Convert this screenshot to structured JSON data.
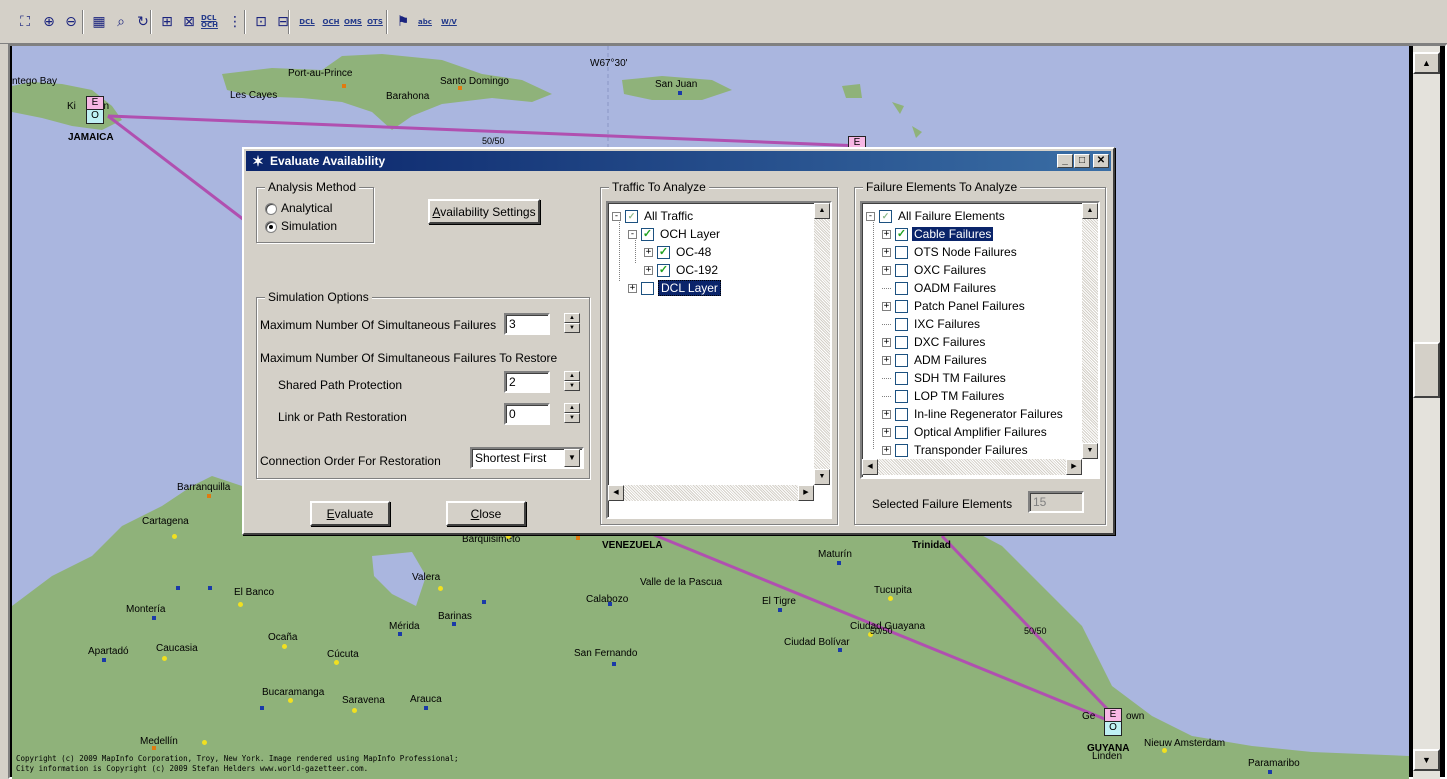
{
  "toolbar": {
    "buttons": [
      {
        "icon": "select-network-icon",
        "glyph": "⛶"
      },
      {
        "icon": "zoom-in-icon",
        "glyph": "⊕"
      },
      {
        "icon": "zoom-out-icon",
        "glyph": "⊖"
      },
      {
        "icon": "grid-view-icon",
        "glyph": "▦"
      },
      {
        "icon": "zoom-region-icon",
        "glyph": "⌕"
      },
      {
        "icon": "zoom-rotate-icon",
        "glyph": "↻"
      },
      {
        "icon": "add-node-icon",
        "glyph": "⊞"
      },
      {
        "icon": "add-link-icon",
        "glyph": "⊠"
      },
      {
        "icon": "dcl-och-icon",
        "label": "DCL OCH"
      },
      {
        "icon": "layer-stack-icon",
        "glyph": "⋮"
      },
      {
        "icon": "expand-icon",
        "glyph": "⊡"
      },
      {
        "icon": "collapse-icon",
        "glyph": "⊟"
      },
      {
        "icon": "dcl-layer-icon",
        "label": "DCL"
      },
      {
        "icon": "och-layer-icon",
        "label": "OCH"
      },
      {
        "icon": "oms-layer-icon",
        "label": "OMS"
      },
      {
        "icon": "ots-layer-icon",
        "label": "OTS"
      },
      {
        "icon": "flag-icon",
        "glyph": "⚑"
      },
      {
        "icon": "label-abc-icon",
        "label": "abc"
      },
      {
        "icon": "label-wv-icon",
        "label": "W/V"
      }
    ]
  },
  "map": {
    "grid_label": "W67°30'",
    "places": [
      {
        "name": "ntego Bay"
      },
      {
        "name": "Port-au-Prince"
      },
      {
        "name": "Santo Domingo"
      },
      {
        "name": "San Juan"
      },
      {
        "name": "Les Cayes"
      },
      {
        "name": "Barahona"
      },
      {
        "name": "Barranquilla"
      },
      {
        "name": "Cartagena"
      },
      {
        "name": "Barquisimeto"
      },
      {
        "name": "Maturín"
      },
      {
        "name": "Valera"
      },
      {
        "name": "Valle de la Pascua"
      },
      {
        "name": "Tucupita"
      },
      {
        "name": "El Banco"
      },
      {
        "name": "Calabozo"
      },
      {
        "name": "El Tigre"
      },
      {
        "name": "Montería"
      },
      {
        "name": "Barinas"
      },
      {
        "name": "Mérida"
      },
      {
        "name": "Ciudad Guayana"
      },
      {
        "name": "Ocaña"
      },
      {
        "name": "Ciudad Bolívar"
      },
      {
        "name": "Caucasia"
      },
      {
        "name": "Apartadó"
      },
      {
        "name": "Cúcuta"
      },
      {
        "name": "San Fernando"
      },
      {
        "name": "Bucaramanga"
      },
      {
        "name": "Saravena"
      },
      {
        "name": "Arauca"
      },
      {
        "name": "Medellín"
      },
      {
        "name": "Nieuw Amsterdam"
      },
      {
        "name": "Paramaribo"
      },
      {
        "name": "Linden"
      },
      {
        "name": "Ge"
      },
      {
        "name": "own"
      },
      {
        "name": "Ki"
      },
      {
        "name": "on"
      }
    ],
    "countries": [
      "JAMAICA",
      "VENEZUELA",
      "Trinidad",
      "GUYANA"
    ],
    "nodes": {
      "e_label": "E",
      "o_label": "O"
    },
    "link_labels": [
      "50/50",
      "50/50",
      "50/50"
    ],
    "copyright_line1": "Copyright (c) 2009 MapInfo Corporation, Troy, New York. Image rendered using MapInfo Professional;",
    "copyright_line2": "City information is Copyright (c) 2009 Stefan Helders www.world-gazetteer.com."
  },
  "dialog": {
    "title": "Evaluate Availability",
    "analysis_method": {
      "label": "Analysis Method",
      "options": [
        "Analytical",
        "Simulation"
      ],
      "selected": "Simulation"
    },
    "availability_settings_button": "Availability Settings",
    "simulation_options": {
      "label": "Simulation Options",
      "max_failures_label": "Maximum Number Of Simultaneous Failures",
      "max_failures_value": "3",
      "max_restore_label": "Maximum Number Of Simultaneous Failures To Restore",
      "shared_path_label": "Shared Path Protection",
      "shared_path_value": "2",
      "link_path_label": "Link or Path Restoration",
      "link_path_value": "0",
      "connection_order_label": "Connection Order For Restoration",
      "connection_order_value": "Shortest First"
    },
    "evaluate_button": "Evaluate",
    "close_button": "Close",
    "traffic": {
      "label": "Traffic To Analyze",
      "items": [
        {
          "label": "All Traffic",
          "checked": "partial"
        },
        {
          "label": "OCH Layer",
          "checked": true
        },
        {
          "label": "OC-48",
          "checked": true
        },
        {
          "label": "OC-192",
          "checked": true
        },
        {
          "label": "DCL Layer",
          "checked": false
        }
      ]
    },
    "failures": {
      "label": "Failure Elements To Analyze",
      "items": [
        {
          "label": "All Failure Elements",
          "checked": "partial"
        },
        {
          "label": "Cable Failures",
          "checked": true
        },
        {
          "label": "OTS Node Failures",
          "checked": false
        },
        {
          "label": "OXC Failures",
          "checked": false
        },
        {
          "label": "OADM Failures",
          "checked": false
        },
        {
          "label": "Patch Panel Failures",
          "checked": false
        },
        {
          "label": "IXC Failures",
          "checked": false
        },
        {
          "label": "DXC Failures",
          "checked": false
        },
        {
          "label": "ADM Failures",
          "checked": false
        },
        {
          "label": "SDH TM Failures",
          "checked": false
        },
        {
          "label": "LOP TM Failures",
          "checked": false
        },
        {
          "label": "In-line Regenerator Failures",
          "checked": false
        },
        {
          "label": "Optical Amplifier Failures",
          "checked": false
        },
        {
          "label": "Transponder Failures",
          "checked": false
        }
      ],
      "selected_count_label": "Selected Failure Elements",
      "selected_count_value": "15"
    }
  }
}
